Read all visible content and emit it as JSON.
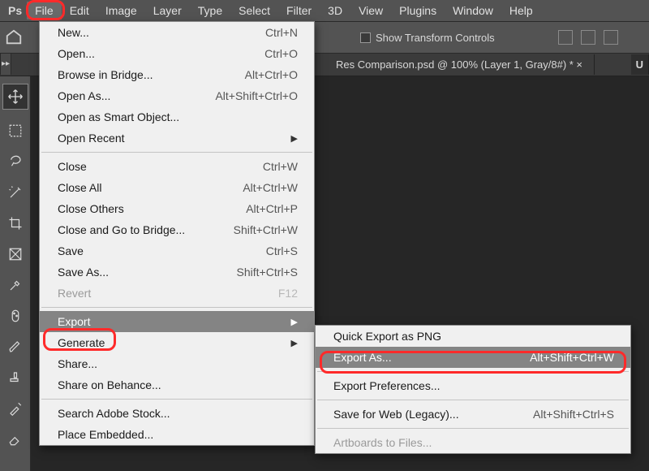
{
  "menubar": {
    "ps": "Ps",
    "items": [
      "File",
      "Edit",
      "Image",
      "Layer",
      "Type",
      "Select",
      "Filter",
      "3D",
      "View",
      "Plugins",
      "Window",
      "Help"
    ]
  },
  "toolbar": {
    "show_transform": "Show Transform Controls"
  },
  "tabbar": {
    "doc_title": "Res Comparison.psd @ 100% (Layer 1, Gray/8#) * ×",
    "right_tab": "U"
  },
  "file_menu": {
    "g1": [
      {
        "label": "New...",
        "accel": "Ctrl+N"
      },
      {
        "label": "Open...",
        "accel": "Ctrl+O"
      },
      {
        "label": "Browse in Bridge...",
        "accel": "Alt+Ctrl+O"
      },
      {
        "label": "Open As...",
        "accel": "Alt+Shift+Ctrl+O"
      },
      {
        "label": "Open as Smart Object...",
        "accel": ""
      },
      {
        "label": "Open Recent",
        "accel": "",
        "arrow": true
      }
    ],
    "g2": [
      {
        "label": "Close",
        "accel": "Ctrl+W"
      },
      {
        "label": "Close All",
        "accel": "Alt+Ctrl+W"
      },
      {
        "label": "Close Others",
        "accel": "Alt+Ctrl+P"
      },
      {
        "label": "Close and Go to Bridge...",
        "accel": "Shift+Ctrl+W"
      },
      {
        "label": "Save",
        "accel": "Ctrl+S"
      },
      {
        "label": "Save As...",
        "accel": "Shift+Ctrl+S"
      },
      {
        "label": "Revert",
        "accel": "F12",
        "disabled": true
      }
    ],
    "g3": [
      {
        "label": "Export",
        "accel": "",
        "arrow": true,
        "hover": true
      },
      {
        "label": "Generate",
        "accel": "",
        "arrow": true
      },
      {
        "label": "Share...",
        "accel": ""
      },
      {
        "label": "Share on Behance...",
        "accel": ""
      }
    ],
    "g4": [
      {
        "label": "Search Adobe Stock...",
        "accel": ""
      },
      {
        "label": "Place Embedded...",
        "accel": ""
      }
    ]
  },
  "export_submenu": {
    "g1": [
      {
        "label": "Quick Export as PNG",
        "accel": ""
      },
      {
        "label": "Export As...",
        "accel": "Alt+Shift+Ctrl+W",
        "hover": true
      }
    ],
    "g2": [
      {
        "label": "Export Preferences...",
        "accel": ""
      }
    ],
    "g3": [
      {
        "label": "Save for Web (Legacy)...",
        "accel": "Alt+Shift+Ctrl+S"
      }
    ],
    "g4": [
      {
        "label": "Artboards to Files...",
        "accel": "",
        "disabled": true
      }
    ]
  }
}
